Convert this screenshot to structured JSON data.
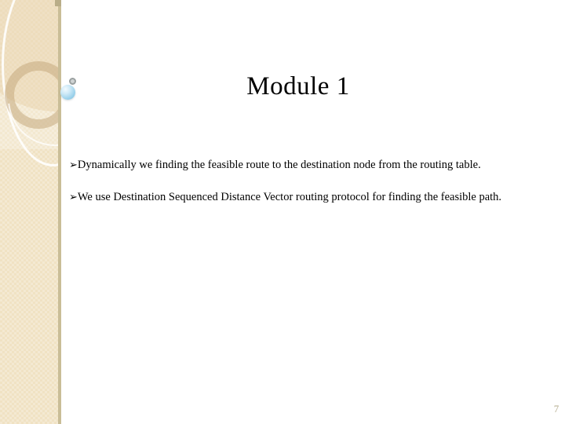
{
  "slide": {
    "title": "Module 1",
    "page_number": "7",
    "bullets": [
      {
        "marker": "➢",
        "text": "Dynamically we finding the feasible route to the destination node from the routing table."
      },
      {
        "marker": "➢",
        "text": "We use Destination Sequenced Distance Vector  routing protocol for finding the feasible path."
      }
    ]
  },
  "decor": {
    "sidebar_color": "#F0E2C3",
    "sidebar_edge_color": "#C9BD97",
    "ring_color": "#C4AA7E",
    "sphere_color": "#9ED3EC",
    "page_number_color": "#B3AB8C",
    "title_color": "#000000",
    "body_color": "#000000",
    "background_color": "#FFFFFF"
  }
}
